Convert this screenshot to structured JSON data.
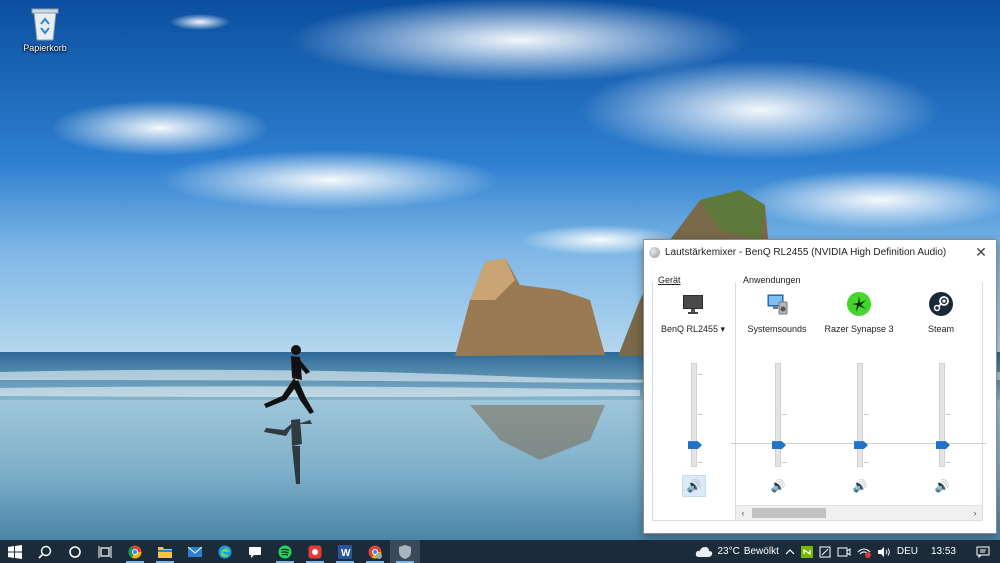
{
  "desktop": {
    "icons": [
      {
        "label": "Papierkorb",
        "icon": "recycle-bin-icon"
      }
    ]
  },
  "mixer": {
    "title": "Lautstärkemixer - BenQ RL2455 (NVIDIA High Definition Audio)",
    "close_glyph": "✕",
    "device_group_label": "Gerät",
    "apps_group_label": "Anwendungen",
    "device": {
      "label": "BenQ RL2455 ▾",
      "volume_percent": 21,
      "muted": false,
      "icon": "monitor-icon"
    },
    "apps": [
      {
        "label": "Systemsounds",
        "icon": "system-sounds-icon",
        "volume_percent": 21
      },
      {
        "label": "Razer Synapse 3",
        "icon": "razer-icon",
        "volume_percent": 21
      },
      {
        "label": "Steam",
        "icon": "steam-icon",
        "volume_percent": 21
      }
    ],
    "speaker_glyph": "🔊",
    "scroll_left": "‹",
    "scroll_right": "›"
  },
  "taskbar": {
    "apps": [
      "start-icon",
      "search-icon",
      "cortana-icon",
      "task-view-icon",
      "chrome-icon",
      "file-explorer-icon",
      "mail-icon",
      "edge-icon",
      "chat-icon",
      "spotify-icon",
      "record-icon",
      "word-icon",
      "chrome-profile-icon",
      "shield-icon"
    ],
    "weather": {
      "temperature": "23°C",
      "condition": "Bewölkt"
    },
    "language": "DEU",
    "time": "13:53",
    "accent": "#7ab6ea"
  },
  "colors": {
    "slider_thumb": "#1f73c9",
    "taskbar_bg": "#1c2b3a"
  }
}
